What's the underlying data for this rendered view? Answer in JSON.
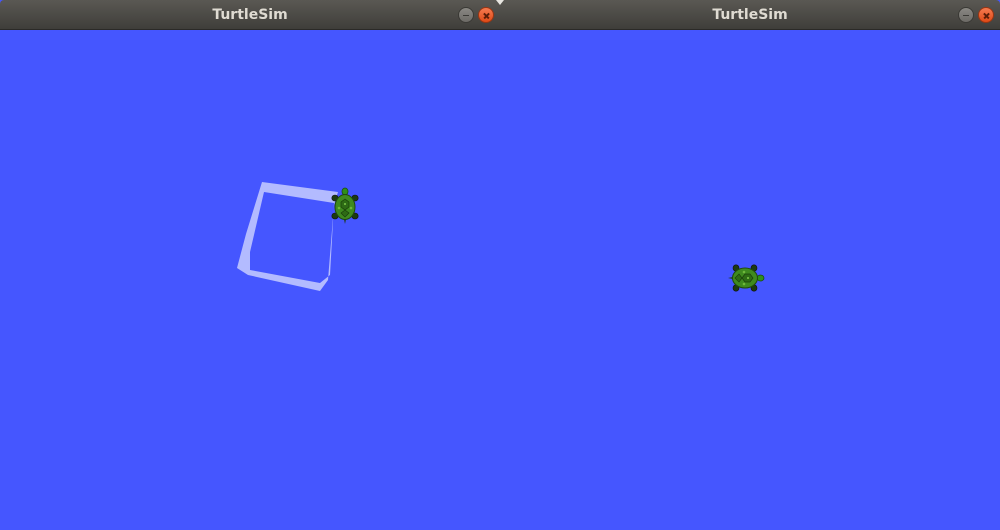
{
  "windows": [
    {
      "title": "TurtleSim",
      "background_color": "#4556ff",
      "pen_color": "#b3bbff",
      "turtle": {
        "icon": "turtle-icon",
        "heading": "up"
      },
      "trail": "square-loop"
    },
    {
      "title": "TurtleSim",
      "background_color": "#4556ff",
      "turtle": {
        "icon": "turtle-icon",
        "heading": "right"
      }
    }
  ],
  "controls": {
    "minimize_icon": "minimize-icon",
    "close_icon": "close-icon"
  }
}
